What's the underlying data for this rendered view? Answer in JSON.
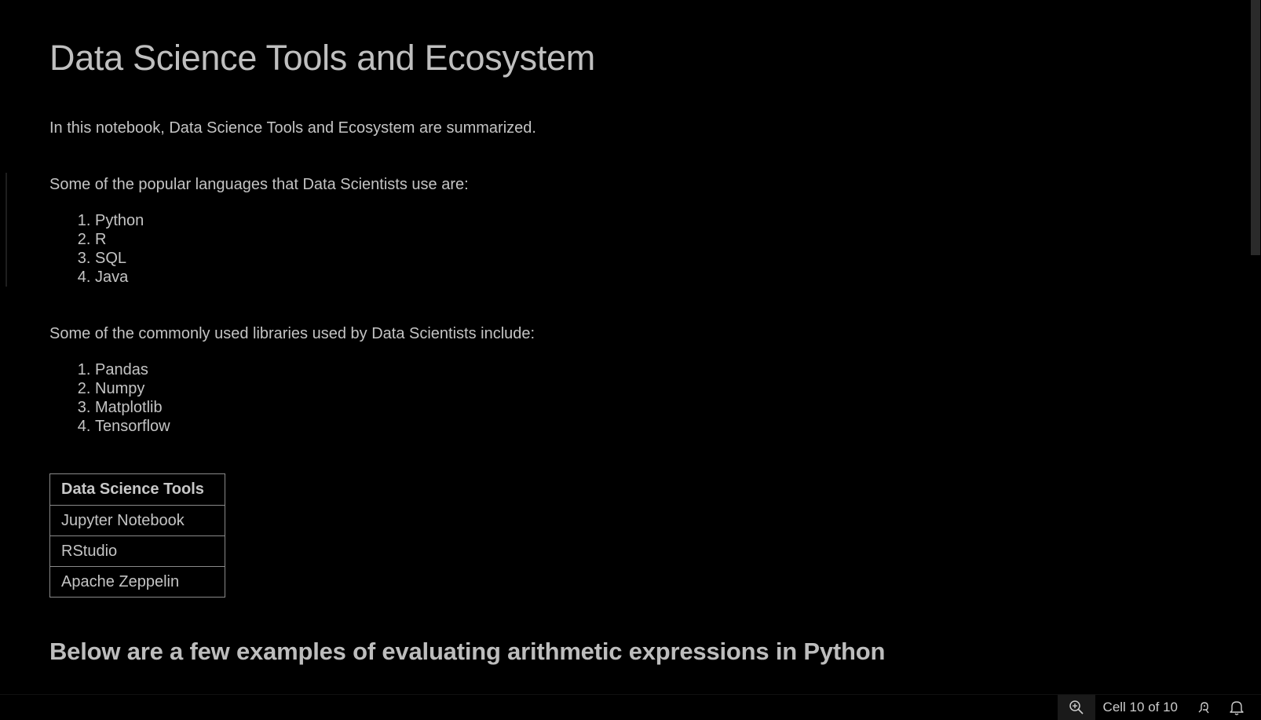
{
  "notebook": {
    "title": "Data Science Tools and Ecosystem",
    "intro": "In this notebook, Data Science Tools and Ecosystem are summarized.",
    "languages_intro": "Some of the popular languages that Data Scientists use are:",
    "languages": [
      "Python",
      "R",
      "SQL",
      "Java"
    ],
    "libraries_intro": "Some of the commonly used libraries used by Data Scientists include:",
    "libraries": [
      "Pandas",
      "Numpy",
      "Matplotlib",
      "Tensorflow"
    ],
    "tools_table": {
      "header": "Data Science Tools",
      "rows": [
        "Jupyter Notebook",
        "RStudio",
        "Apache Zeppelin"
      ]
    },
    "examples_heading": "Below are a few examples of evaluating arithmetic expressions in Python"
  },
  "statusbar": {
    "zoom_icon": "zoom-in-icon",
    "cell_status": "Cell 10 of 10",
    "feedback_icon": "feedback-icon",
    "notifications_icon": "bell-icon"
  },
  "colors": {
    "background": "#000000",
    "text": "#c4c4c4",
    "table_border": "#8a8a8a"
  }
}
